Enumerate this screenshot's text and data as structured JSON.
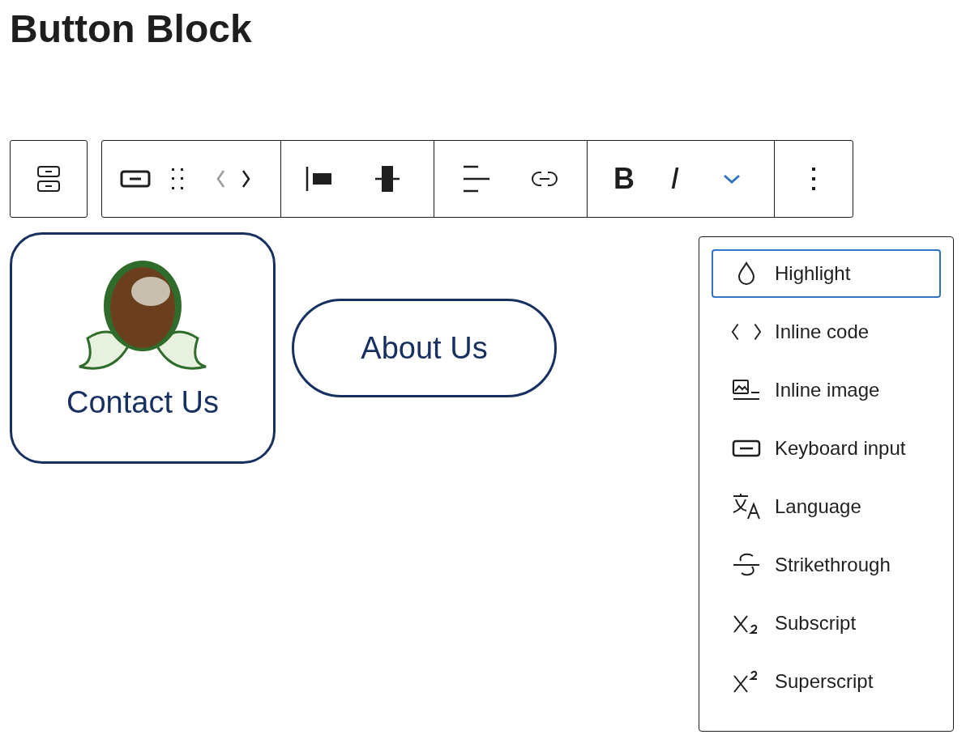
{
  "page_title": "Button Block",
  "toolbar": {
    "groups": [
      {
        "tools": [
          {
            "kind": "stack"
          }
        ]
      },
      {
        "tools": [
          {
            "kind": "button"
          },
          {
            "kind": "drag"
          },
          {
            "kind": "move"
          }
        ]
      },
      {
        "tools": [
          {
            "kind": "align-left"
          },
          {
            "kind": "justify-center"
          }
        ]
      },
      {
        "tools": [
          {
            "kind": "text-align"
          },
          {
            "kind": "link"
          }
        ]
      },
      {
        "tools": [
          {
            "kind": "bold",
            "glyph": "B"
          },
          {
            "kind": "italic",
            "glyph": "I"
          },
          {
            "kind": "more-formats",
            "expanded": true
          }
        ]
      },
      {
        "tools": [
          {
            "kind": "options"
          }
        ]
      }
    ]
  },
  "buttons": [
    {
      "label": "Contact Us",
      "has_image": true
    },
    {
      "label": "About Us",
      "has_image": false
    }
  ],
  "format_menu": {
    "items": [
      {
        "kind": "highlight",
        "label": "Highlight",
        "selected": true
      },
      {
        "kind": "code",
        "label": "Inline code",
        "selected": false
      },
      {
        "kind": "image",
        "label": "Inline image",
        "selected": false
      },
      {
        "kind": "keyboard",
        "label": "Keyboard input",
        "selected": false
      },
      {
        "kind": "language",
        "label": "Language",
        "selected": false
      },
      {
        "kind": "strike",
        "label": "Strikethrough",
        "selected": false
      },
      {
        "kind": "subscript",
        "label": "Subscript",
        "selected": false
      },
      {
        "kind": "superscript",
        "label": "Superscript",
        "selected": false
      }
    ]
  }
}
